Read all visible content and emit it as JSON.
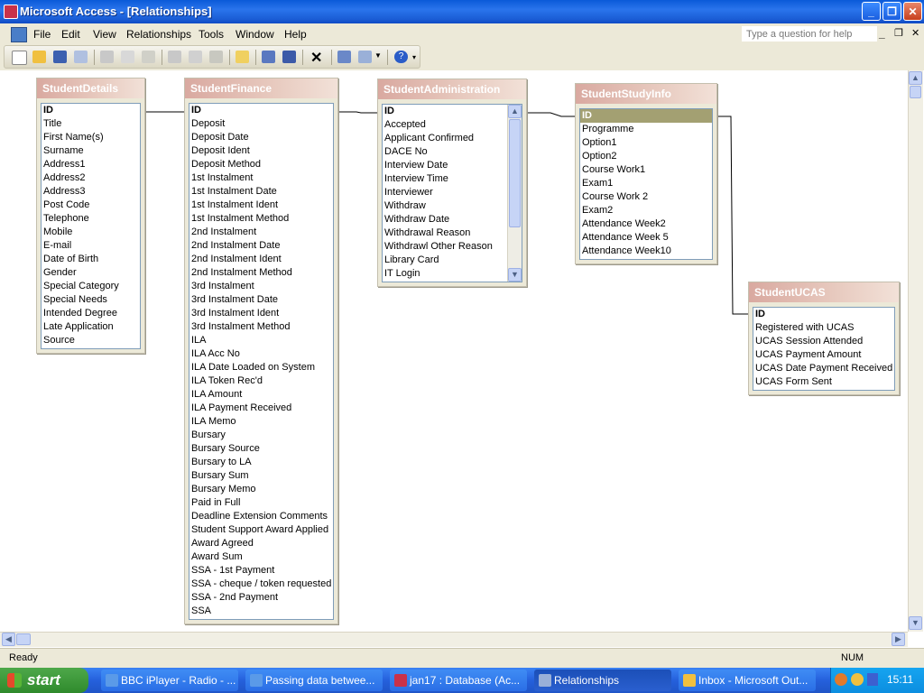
{
  "window": {
    "title": "Microsoft Access - [Relationships]"
  },
  "menubar": {
    "items": [
      "File",
      "Edit",
      "View",
      "Relationships",
      "Tools",
      "Window",
      "Help"
    ],
    "help_placeholder": "Type a question for help"
  },
  "tables": [
    {
      "name": "StudentDetails",
      "fields": [
        "ID",
        "Title",
        "First Name(s)",
        "Surname",
        "Address1",
        "Address2",
        "Address3",
        "Post Code",
        "Telephone",
        "Mobile",
        "E-mail",
        "Date of Birth",
        "Gender",
        "Special Category",
        "Special Needs",
        "Intended Degree",
        "Late Application",
        "Source"
      ]
    },
    {
      "name": "StudentFinance",
      "fields": [
        "ID",
        "Deposit",
        "Deposit Date",
        "Deposit Ident",
        "Deposit Method",
        "1st Instalment",
        "1st Instalment Date",
        "1st Instalment Ident",
        "1st Instalment Method",
        "2nd Instalment",
        "2nd Instalment Date",
        "2nd Instalment Ident",
        "2nd Instalment Method",
        "3rd Instalment",
        "3rd Instalment Date",
        "3rd Instalment Ident",
        "3rd Instalment Method",
        "ILA",
        "ILA Acc No",
        "ILA Date Loaded on System",
        "ILA Token Rec'd",
        "ILA Amount",
        "ILA Payment Received",
        "ILA Memo",
        "Bursary",
        "Bursary Source",
        "Bursary to LA",
        "Bursary Sum",
        "Bursary Memo",
        "Paid in Full",
        "Deadline Extension Comments",
        "Student Support Award Applied",
        "Award Agreed",
        "Award Sum",
        "SSA - 1st Payment",
        "SSA - cheque / token requested",
        "SSA - 2nd Payment",
        "SSA"
      ]
    },
    {
      "name": "StudentAdministration",
      "fields": [
        "ID",
        "Accepted",
        "Applicant Confirmed",
        "DACE No",
        "Interview Date",
        "Interview Time",
        "Interviewer",
        "Withdraw",
        "Withdraw Date",
        "Withdrawal Reason",
        "Withdrawl Other Reason",
        "Library Card",
        "IT Login"
      ]
    },
    {
      "name": "StudentStudyInfo",
      "fields": [
        "ID",
        "Programme",
        "Option1",
        "Option2",
        "Course Work1",
        "Exam1",
        "Course Work 2",
        "Exam2",
        "Attendance Week2",
        "Attendance Week 5",
        "Attendance Week10"
      ]
    },
    {
      "name": "StudentUCAS",
      "fields": [
        "ID",
        "Registered with UCAS",
        "UCAS Session Attended",
        "UCAS Payment Amount",
        "UCAS Date Payment Received",
        "UCAS Form Sent"
      ]
    }
  ],
  "statusbar": {
    "left": "Ready",
    "num": "NUM"
  },
  "taskbar": {
    "start_label": "start",
    "tasks": [
      "BBC iPlayer - Radio - ...",
      "Passing data betwee...",
      "jan17 : Database (Ac...",
      "Relationships",
      "Inbox - Microsoft Out..."
    ],
    "clock": "15:11"
  },
  "colors": {
    "accent": "#0a5ad8",
    "selected_row": "#a3a072",
    "header_gradient": "#d9a9a0"
  }
}
